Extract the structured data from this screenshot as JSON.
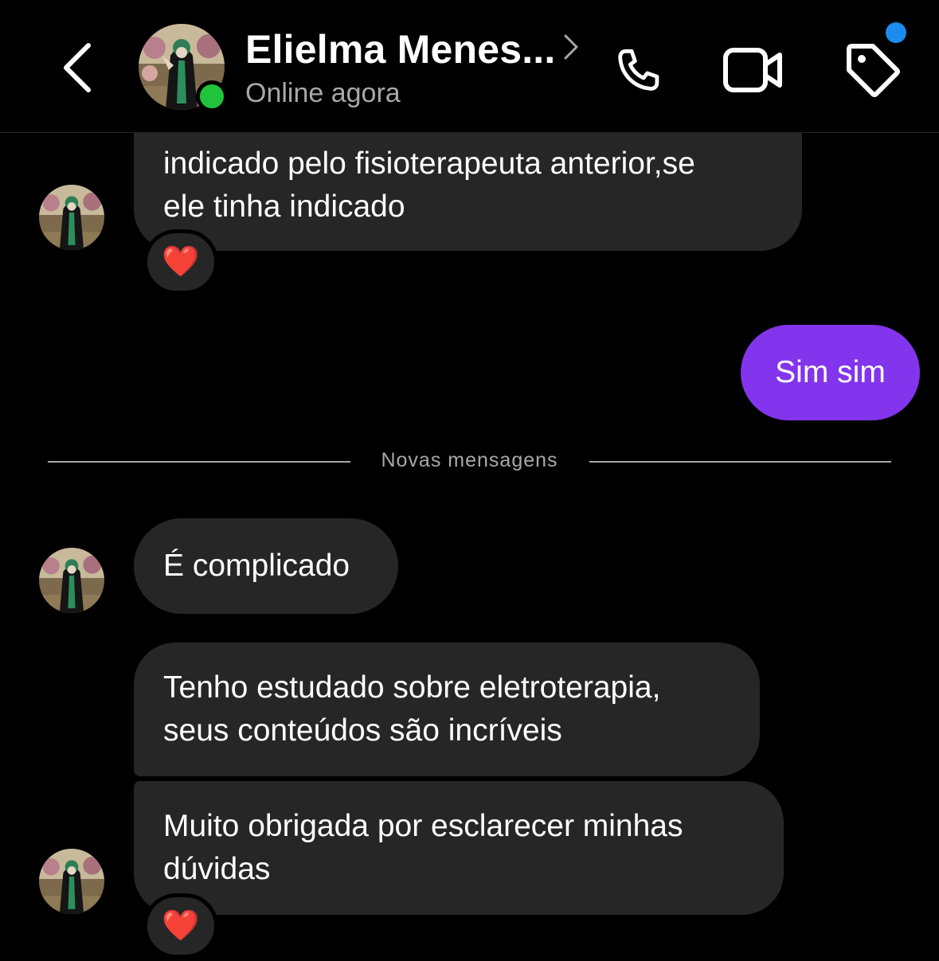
{
  "header": {
    "contact_name": "Elielma Menes...",
    "status": "Online agora",
    "icons": {
      "back": "chevron-left-icon",
      "name_chevron": "chevron-right-icon",
      "call": "phone-icon",
      "video": "video-camera-icon",
      "tag": "tag-icon"
    },
    "online_color": "#1fc43a",
    "notification_color": "#1c8cf0"
  },
  "messages": [
    {
      "direction": "incoming",
      "lines": [
        "indicado pelo fisioterapeuta anterior,se",
        "ele tinha indicado"
      ],
      "reaction": "❤️"
    },
    {
      "direction": "outgoing",
      "text": "Sim sim"
    },
    {
      "direction": "incoming",
      "text": "É complicado"
    },
    {
      "direction": "incoming",
      "lines": [
        "Tenho estudado sobre eletroterapia,",
        "seus conteúdos são incríveis"
      ]
    },
    {
      "direction": "incoming",
      "lines": [
        "Muito obrigada por esclarecer minhas",
        "dúvidas"
      ],
      "reaction": "❤️"
    }
  ],
  "divider": {
    "label": "Novas mensagens"
  },
  "colors": {
    "background": "#000000",
    "incoming_bubble": "#262626",
    "outgoing_bubble": "#8235ec",
    "secondary_text": "#a8a8a8"
  }
}
